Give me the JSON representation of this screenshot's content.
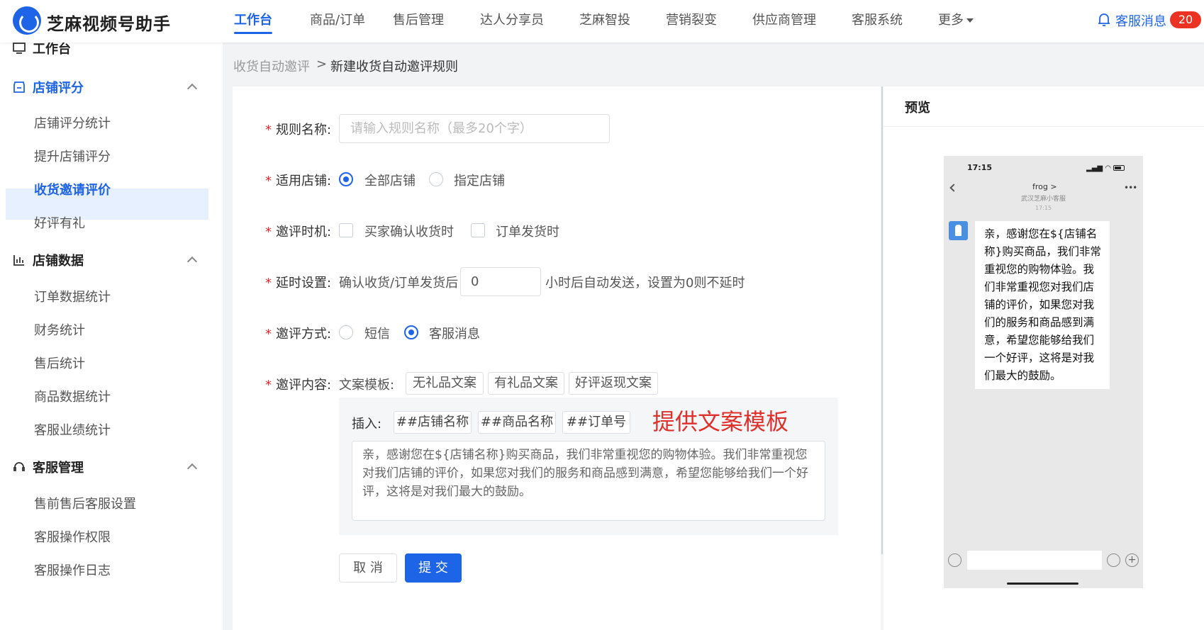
{
  "header": {
    "brand": "芝麻视频号助手",
    "nav": [
      "工作台",
      "商品/订单",
      "售后管理",
      "达人分享员",
      "芝麻智投",
      "营销裂变",
      "供应商管理",
      "客服系统",
      "更多"
    ],
    "active_nav": "工作台",
    "cs_message_label": "客服消息",
    "cs_message_count": "20",
    "accent_color": "#1e64e6",
    "badge_color": "#ea3323"
  },
  "sidebar": {
    "top_item": "工作台",
    "groups": [
      {
        "title": "店铺评分",
        "items": [
          "店铺评分统计",
          "提升店铺评分",
          "收货邀请评价",
          "好评有礼"
        ]
      },
      {
        "title": "店铺数据",
        "items": [
          "订单数据统计",
          "财务统计",
          "售后统计",
          "商品数据统计",
          "客服业绩统计"
        ]
      },
      {
        "title": "客服管理",
        "items": [
          "售前售后客服设置",
          "客服操作权限",
          "客服操作日志"
        ]
      }
    ],
    "active_item": "收货邀请评价"
  },
  "breadcrumb": {
    "parent": "收货自动邀评",
    "separator": ">",
    "current": "新建收货自动邀评规则"
  },
  "form": {
    "rule_name": {
      "label": "规则名称:",
      "placeholder": "请输入规则名称（最多20个字）"
    },
    "shop": {
      "label": "适用店铺:",
      "options": [
        "全部店铺",
        "指定店铺"
      ],
      "selected": "全部店铺"
    },
    "timing": {
      "label": "邀评时机:",
      "options": [
        "买家确认收货时",
        "订单发货时"
      ]
    },
    "delay": {
      "label": "延时设置:",
      "prefix": "确认收货/订单发货后",
      "value": "0",
      "suffix": "小时后自动发送，设置为0则不延时"
    },
    "method": {
      "label": "邀评方式:",
      "options": [
        "短信",
        "客服消息"
      ],
      "selected": "客服消息"
    },
    "content": {
      "label": "邀评内容:",
      "template_label": "文案模板:",
      "templates": [
        "无礼品文案",
        "有礼品文案",
        "好评返现文案"
      ],
      "insert_label": "插入:",
      "insert_tags": [
        "##店铺名称",
        "##商品名称",
        "##订单号"
      ],
      "note": "提供文案模板",
      "message": "亲，感谢您在${店铺名称}购买商品，我们非常重视您的购物体验。我们非常重视您对我们店铺的评价，如果您对我们的服务和商品感到满意，希望您能够给我们一个好评，这将是对我们最大的鼓励。"
    },
    "cancel_label": "取 消",
    "submit_label": "提 交"
  },
  "preview": {
    "title": "预览",
    "phone_time": "17:15",
    "chat_name": "frog >",
    "chat_shop": "武汉芝麻小客服",
    "chat_timestamp": "17:15",
    "bubble_text": "亲，感谢您在${店铺名称}购买商品，我们非常重视您的购物体验。我们非常重视您对我们店铺的评价，如果您对我们的服务和商品感到满意，希望您能够给我们一个好评，这将是对我们最大的鼓励。"
  }
}
